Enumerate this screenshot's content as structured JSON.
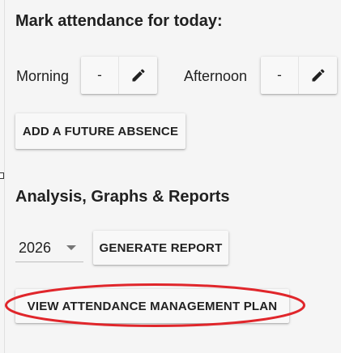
{
  "attendance": {
    "heading": "Mark attendance for today:",
    "morning": {
      "label": "Morning",
      "value": "-"
    },
    "afternoon": {
      "label": "Afternoon",
      "value": "-"
    },
    "future_absence_label": "ADD A FUTURE ABSENCE"
  },
  "reports": {
    "heading": "Analysis, Graphs & Reports",
    "year_value": "2026",
    "generate_label": "GENERATE REPORT",
    "plan_label": "VIEW ATTENDANCE MANAGEMENT PLAN"
  },
  "annotation": {
    "color": "#e0262b"
  },
  "icons": {
    "edit": "pencil-icon",
    "dropdown": "caret-down-icon"
  }
}
